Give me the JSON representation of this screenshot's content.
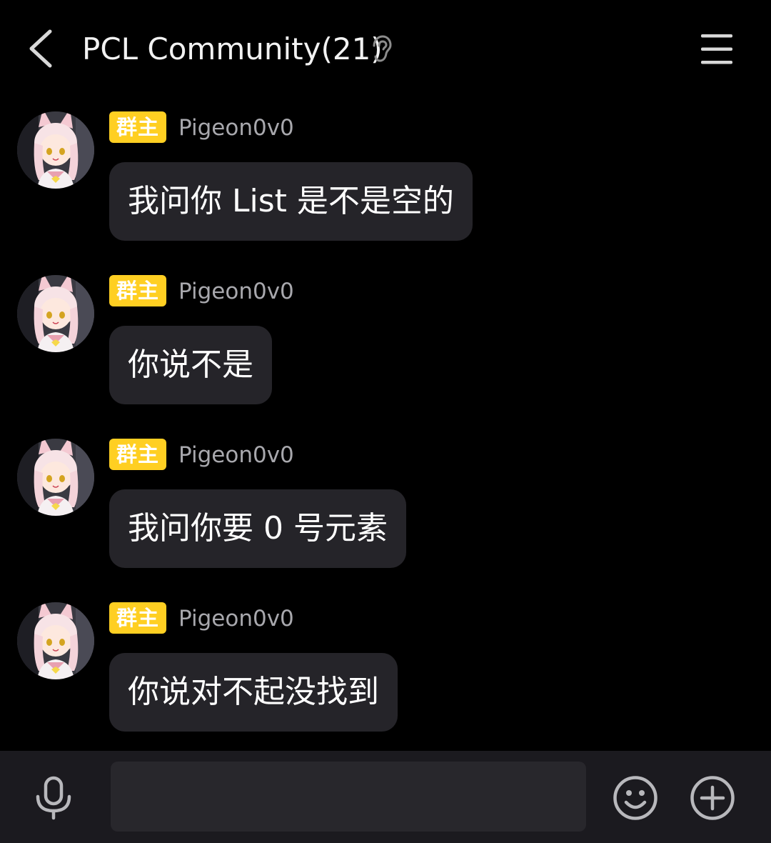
{
  "header": {
    "title": "PCL Community(21)",
    "back_icon": "chevron-left-icon",
    "listen_icon": "ear-icon",
    "menu_icon": "hamburger-menu-icon"
  },
  "messages": [
    {
      "badge": "群主",
      "sender": "Pigeon0v0",
      "text": "我问你 List 是不是空的"
    },
    {
      "badge": "群主",
      "sender": "Pigeon0v0",
      "text": "你说不是"
    },
    {
      "badge": "群主",
      "sender": "Pigeon0v0",
      "text": "我问你要 0 号元素"
    },
    {
      "badge": "群主",
      "sender": "Pigeon0v0",
      "text": "你说对不起没找到"
    }
  ],
  "input_bar": {
    "mic_icon": "microphone-icon",
    "input_value": "",
    "emoji_icon": "smiley-icon",
    "plus_icon": "plus-circle-icon"
  },
  "colors": {
    "background": "#000000",
    "bubble": "#252429",
    "badge": "#ffcf22",
    "sender": "#a8a8ad",
    "input_bar": "#1b1a1f"
  }
}
